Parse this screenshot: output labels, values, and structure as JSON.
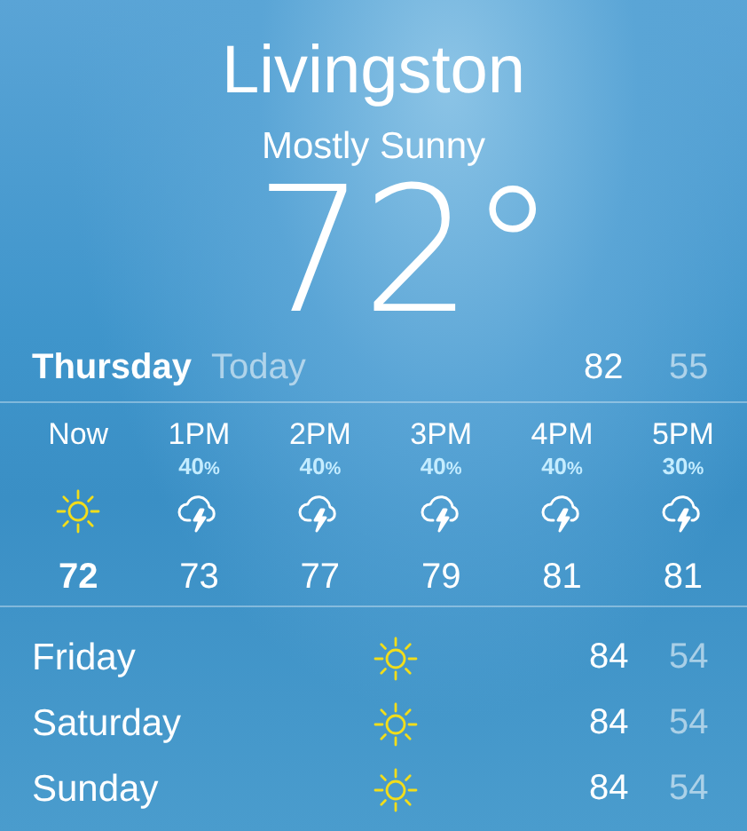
{
  "location": {
    "city": "Livingston",
    "condition": "Mostly Sunny",
    "temperature": "72°"
  },
  "today": {
    "day": "Thursday",
    "label": "Today",
    "high": "82",
    "low": "55"
  },
  "hourly": [
    {
      "time": "Now",
      "kind": "sun",
      "temp": "72",
      "now": true
    },
    {
      "time": "1PM",
      "precip": "40",
      "unit": "%",
      "kind": "storm",
      "temp": "73",
      "now": false
    },
    {
      "time": "2PM",
      "precip": "40",
      "unit": "%",
      "kind": "storm",
      "temp": "77",
      "now": false
    },
    {
      "time": "3PM",
      "precip": "40",
      "unit": "%",
      "kind": "storm",
      "temp": "79",
      "now": false
    },
    {
      "time": "4PM",
      "precip": "40",
      "unit": "%",
      "kind": "storm",
      "temp": "81",
      "now": false
    },
    {
      "time": "5PM",
      "precip": "30",
      "unit": "%",
      "kind": "storm",
      "temp": "81",
      "now": false
    }
  ],
  "daily": [
    {
      "day": "Friday",
      "kind": "sun",
      "high": "84",
      "low": "54"
    },
    {
      "day": "Saturday",
      "kind": "sun",
      "high": "84",
      "low": "54"
    },
    {
      "day": "Sunday",
      "kind": "sun",
      "high": "84",
      "low": "54"
    }
  ]
}
